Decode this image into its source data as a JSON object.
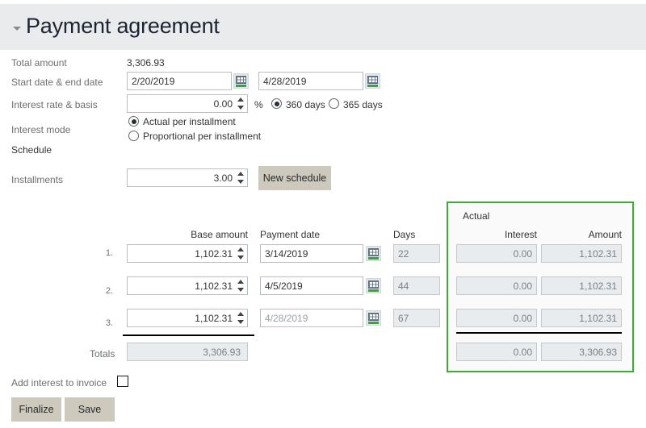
{
  "header": {
    "title": "Payment agreement",
    "collapse_icon": "caret-down-icon"
  },
  "form": {
    "total_amount_label": "Total amount",
    "total_amount_value": "3,306.93",
    "dates_label": "Start date & end date",
    "start_date": "2/20/2019",
    "end_date": "4/28/2019",
    "calendar_icon": "calendar-icon",
    "interest_label": "Interest rate & basis",
    "interest_rate": "0.00",
    "percent_symbol": "%",
    "basis_360": "360 days",
    "basis_365": "365 days",
    "basis_selected": "360 days",
    "interest_mode_label": "Interest mode",
    "mode_actual": "Actual per installment",
    "mode_proportional": "Proportional per installment",
    "mode_selected": "Actual per installment",
    "schedule_label": "Schedule",
    "installments_label": "Installments",
    "installments_value": "3.00",
    "new_schedule_label": "New schedule"
  },
  "table": {
    "headers": {
      "base_amount": "Base amount",
      "payment_date": "Payment date",
      "days": "Days"
    },
    "rows": [
      {
        "num": "1.",
        "base_amount": "1,102.31",
        "payment_date": "3/14/2019",
        "days": "22",
        "date_readonly": false
      },
      {
        "num": "2.",
        "base_amount": "1,102.31",
        "payment_date": "4/5/2019",
        "days": "44",
        "date_readonly": false
      },
      {
        "num": "3.",
        "base_amount": "1,102.31",
        "payment_date": "4/28/2019",
        "days": "67",
        "date_readonly": true
      }
    ],
    "totals_label": "Totals",
    "totals_value": "3,306.93"
  },
  "actual": {
    "group_title": "Actual",
    "headers": {
      "interest": "Interest",
      "amount": "Amount"
    },
    "rows": [
      {
        "interest": "0.00",
        "amount": "1,102.31"
      },
      {
        "interest": "0.00",
        "amount": "1,102.31"
      },
      {
        "interest": "0.00",
        "amount": "1,102.31"
      }
    ],
    "totals": {
      "interest": "0.00",
      "amount": "3,306.93"
    },
    "border_color": "#3faa35"
  },
  "footer": {
    "add_interest_label": "Add interest to invoice",
    "add_interest_checked": false,
    "finalize_label": "Finalize",
    "save_label": "Save"
  }
}
